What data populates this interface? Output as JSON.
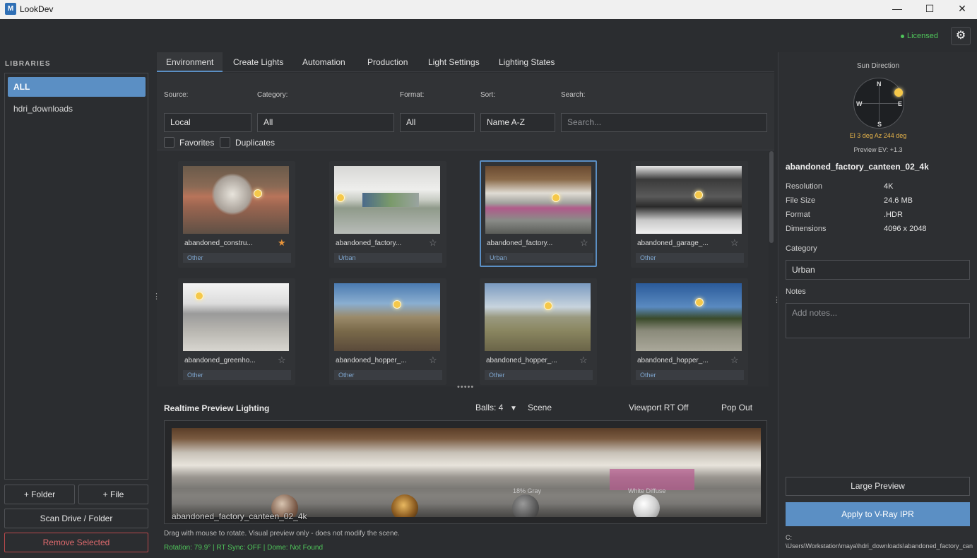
{
  "window": {
    "title": "LookDev",
    "app_icon": "M",
    "minimize": "—",
    "maximize": "☐",
    "close": "✕"
  },
  "header": {
    "license_status": "Licensed",
    "settings_icon": "⚙"
  },
  "libraries": {
    "heading": "LIBRARIES",
    "items": [
      {
        "label": "ALL",
        "active": true
      },
      {
        "label": "hdri_downloads",
        "active": false
      }
    ],
    "add_folder": "+ Folder",
    "add_file": "+ File",
    "scan": "Scan Drive / Folder",
    "remove": "Remove Selected"
  },
  "tabs": [
    "Environment",
    "Create Lights",
    "Automation",
    "Production",
    "Light Settings",
    "Lighting States"
  ],
  "filters": {
    "source_label": "Source:",
    "source_value": "Local",
    "category_label": "Category:",
    "category_value": "All",
    "format_label": "Format:",
    "format_value": "All",
    "sort_label": "Sort:",
    "sort_value": "Name A-Z",
    "search_label": "Search:",
    "search_placeholder": "Search...",
    "favorites_label": "Favorites",
    "duplicates_label": "Duplicates"
  },
  "grid": {
    "cards": [
      {
        "name": "abandoned_constru...",
        "tag": "Other",
        "favorite": true,
        "selected": false
      },
      {
        "name": "abandoned_factory...",
        "tag": "Urban",
        "favorite": false,
        "selected": false
      },
      {
        "name": "abandoned_factory...",
        "tag": "Urban",
        "favorite": false,
        "selected": true
      },
      {
        "name": "abandoned_garage_...",
        "tag": "Other",
        "favorite": false,
        "selected": false
      },
      {
        "name": "abandoned_greenho...",
        "tag": "Other",
        "favorite": false,
        "selected": false
      },
      {
        "name": "abandoned_hopper_...",
        "tag": "Other",
        "favorite": false,
        "selected": false
      },
      {
        "name": "abandoned_hopper_...",
        "tag": "Other",
        "favorite": false,
        "selected": false
      },
      {
        "name": "abandoned_hopper_...",
        "tag": "Other",
        "favorite": false,
        "selected": false
      }
    ],
    "star_filled": "★",
    "star_empty": "☆"
  },
  "preview": {
    "title": "Realtime Preview Lighting",
    "balls": "Balls: 4",
    "scene": "Scene",
    "viewport_rt": "Viewport RT Off",
    "pop_out": "Pop Out",
    "ball_labels": [
      "18% Gray",
      "White Diffuse"
    ],
    "hdri_name": "abandoned_factory_canteen_02_4k",
    "hint": "Drag with mouse to rotate. Visual preview only - does not modify the scene.",
    "status": "Rotation: 79.9° | RT Sync: OFF | Dome: Not Found"
  },
  "details": {
    "sun_direction": "Sun Direction",
    "compass": {
      "n": "N",
      "s": "S",
      "e": "E",
      "w": "W"
    },
    "sun_angles": "El 3 deg  Az 244 deg",
    "preview_ev": "Preview EV: +1.3",
    "asset_name": "abandoned_factory_canteen_02_4k",
    "properties": [
      {
        "key": "Resolution",
        "value": "4K"
      },
      {
        "key": "File Size",
        "value": "24.6 MB"
      },
      {
        "key": "Format",
        "value": ".HDR"
      },
      {
        "key": "Dimensions",
        "value": "4096 x 2048"
      }
    ],
    "category_label": "Category",
    "category_value": "Urban",
    "notes_label": "Notes",
    "notes_placeholder": "Add notes...",
    "large_preview": "Large Preview",
    "apply": "Apply to V-Ray IPR",
    "path_line1": "C:",
    "path_line2": "\\Users\\Workstation\\maya\\hdri_downloads\\abandoned_factory_can"
  },
  "colors": {
    "accent": "#5b8fc4",
    "licensed": "#4fc55a",
    "danger": "#e06b6e",
    "favorite": "#e8943a"
  }
}
